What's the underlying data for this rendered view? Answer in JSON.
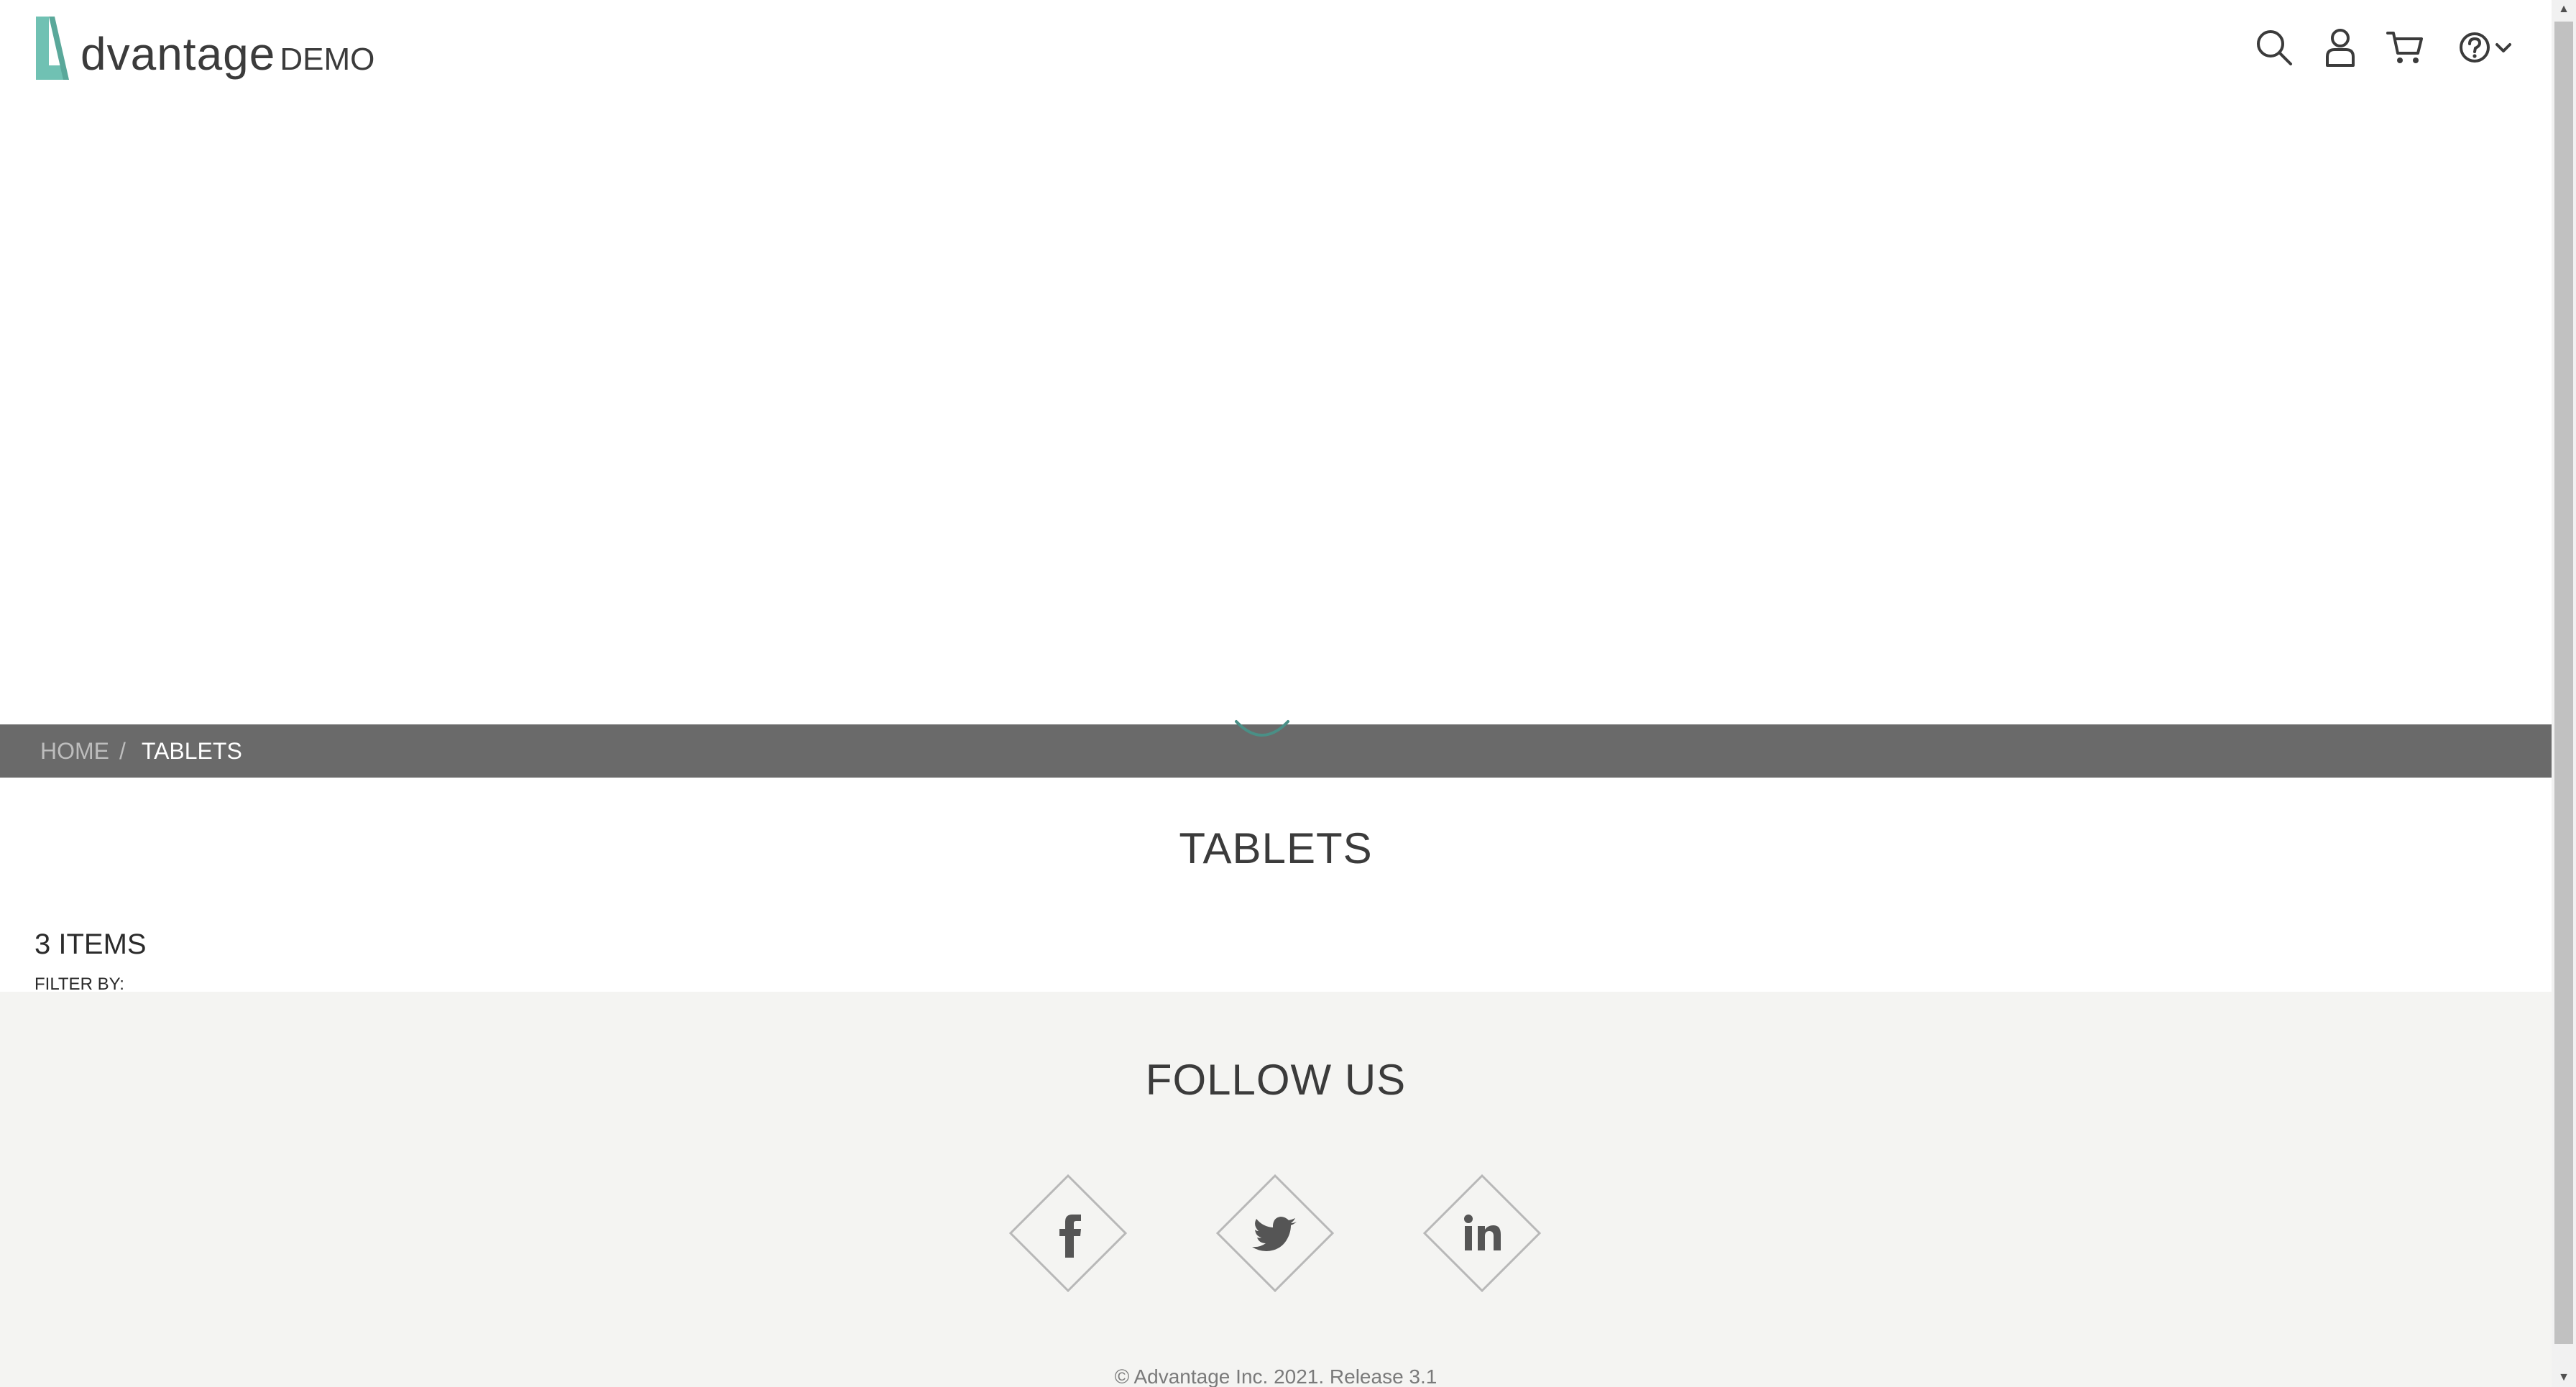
{
  "header": {
    "logo": {
      "word": "dvantage",
      "suffix": "DEMO"
    },
    "icons": [
      "search-icon",
      "user-icon",
      "cart-icon",
      "help-icon",
      "chevron-down-icon"
    ]
  },
  "breadcrumb": {
    "home": "HOME",
    "separator": "/",
    "current": "TABLETS"
  },
  "category": {
    "title": "TABLETS",
    "items_count": "3 ITEMS",
    "filter_label": "FILTER BY:"
  },
  "footer": {
    "follow_title": "FOLLOW US",
    "social": [
      "facebook-icon",
      "twitter-icon",
      "linkedin-icon"
    ],
    "copyright": "© Advantage Inc. 2021. Release 3.1"
  },
  "colors": {
    "accent": "#70c1b3",
    "breadcrumb_bg": "#6a6a6a",
    "footer_bg": "#f4f4f2",
    "text": "#3b3b3b"
  }
}
